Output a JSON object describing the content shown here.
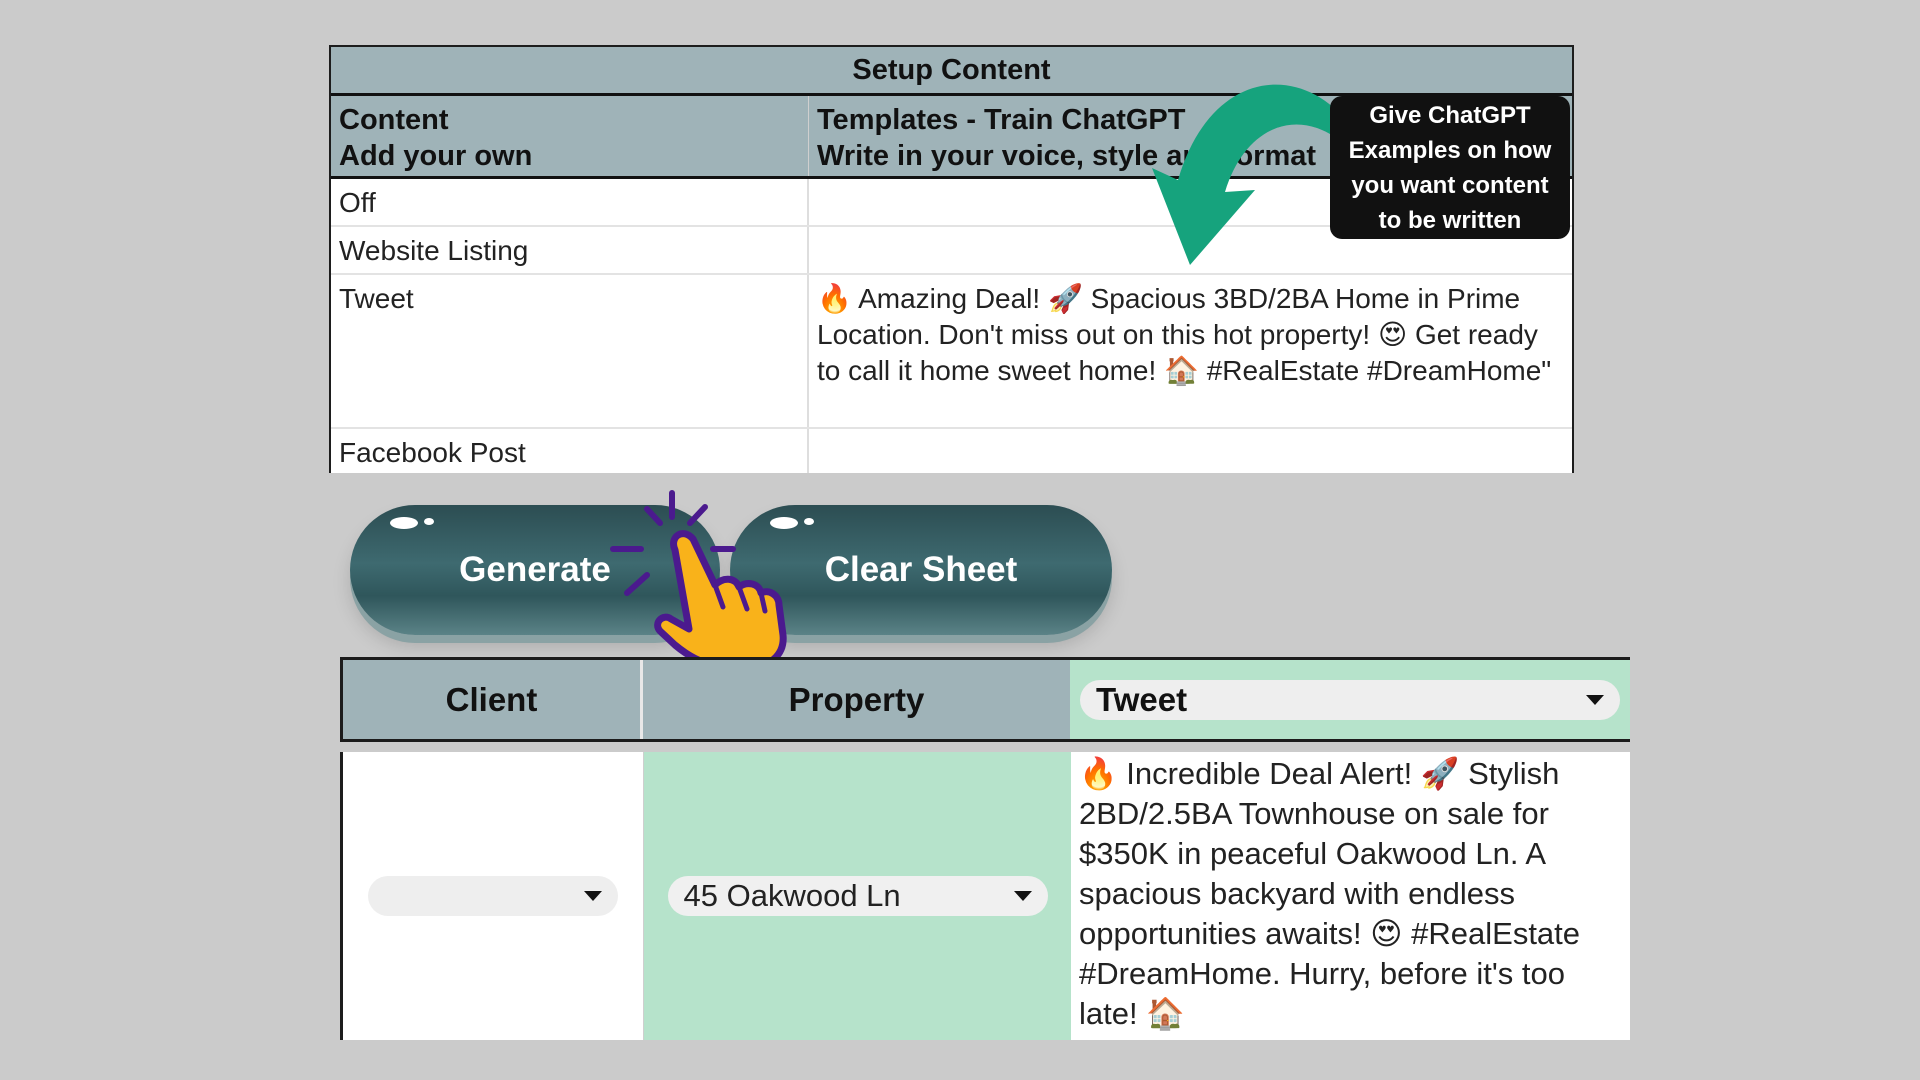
{
  "setup": {
    "title": "Setup Content",
    "header_col1_line1": "Content",
    "header_col1_line2": "Add your own",
    "header_col2_line1": "Templates - Train ChatGPT",
    "header_col2_line2": "Write in your voice, style and format",
    "rows": [
      {
        "content": "Off",
        "template": ""
      },
      {
        "content": "Website Listing",
        "template": ""
      },
      {
        "content": "Tweet",
        "template": "🔥 Amazing Deal! 🚀 Spacious 3BD/2BA Home in Prime Location. Don't miss out on this hot property! 😍 Get ready to call it home sweet home! 🏠 #RealEstate #DreamHome\""
      },
      {
        "content": "Facebook Post",
        "template": ""
      }
    ]
  },
  "callout": {
    "line1": "Give ChatGPT",
    "line2": "Examples on how",
    "line3": "you want content",
    "line4": "to be written"
  },
  "buttons": {
    "generate": "Generate",
    "clear": "Clear Sheet"
  },
  "output": {
    "col_client": "Client",
    "col_property": "Property",
    "content_type": "Tweet",
    "client_value": "",
    "property_value": "45 Oakwood Ln",
    "generated_text": "🔥 Incredible Deal Alert! 🚀 Stylish 2BD/2.5BA Townhouse on sale for $350K in peaceful Oakwood Ln. A spacious backyard with endless opportunities awaits! 😍 #RealEstate #DreamHome. Hurry, before it's too late! 🏠"
  },
  "colors": {
    "header_gray": "#9fb3b8",
    "mint": "#b6e3cb",
    "button": "#3e6a70",
    "arrow": "#16a37d",
    "hand": "#f9b21a",
    "hand_outline": "#4b1a8e"
  }
}
